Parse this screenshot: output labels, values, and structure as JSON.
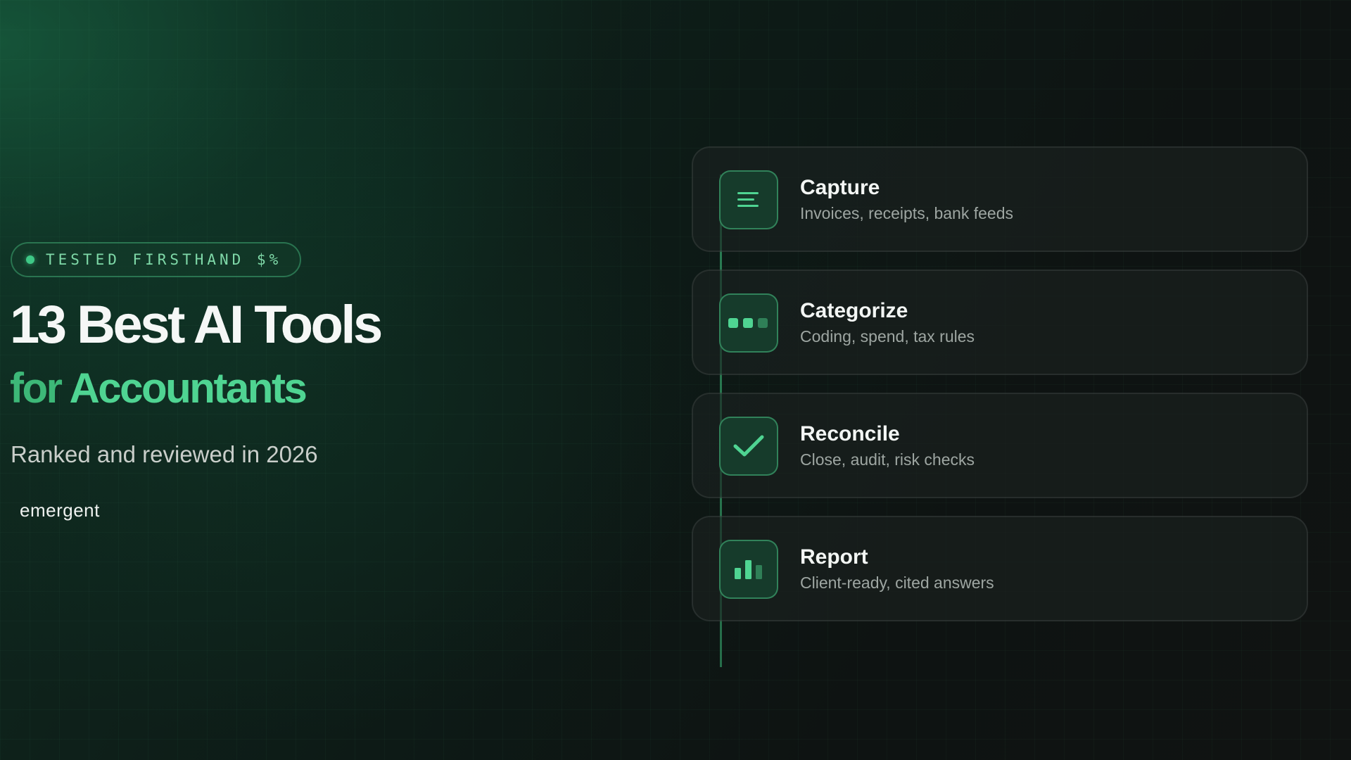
{
  "badge": {
    "text": "TESTED FIRSTHAND $%"
  },
  "headline": {
    "line1": "13 Best AI Tools",
    "line2_prefix": "for",
    "line2_highlight": "Accountants"
  },
  "subtitle": "Ranked and reviewed in 2026",
  "brand": "emergent",
  "steps": [
    {
      "title": "Capture",
      "description": "Invoices, receipts, bank feeds",
      "icon": "lines-icon"
    },
    {
      "title": "Categorize",
      "description": "Coding, spend, tax rules",
      "icon": "dots-icon"
    },
    {
      "title": "Reconcile",
      "description": "Close, audit, risk checks",
      "icon": "check-icon"
    },
    {
      "title": "Report",
      "description": "Client-ready, cited answers",
      "icon": "bar-chart-icon"
    }
  ],
  "colors": {
    "accent": "#3ec886",
    "accent_light": "#4fd492",
    "background": "#0c1311",
    "card_bg": "#1c2220",
    "icon_bg": "#163b2b"
  }
}
